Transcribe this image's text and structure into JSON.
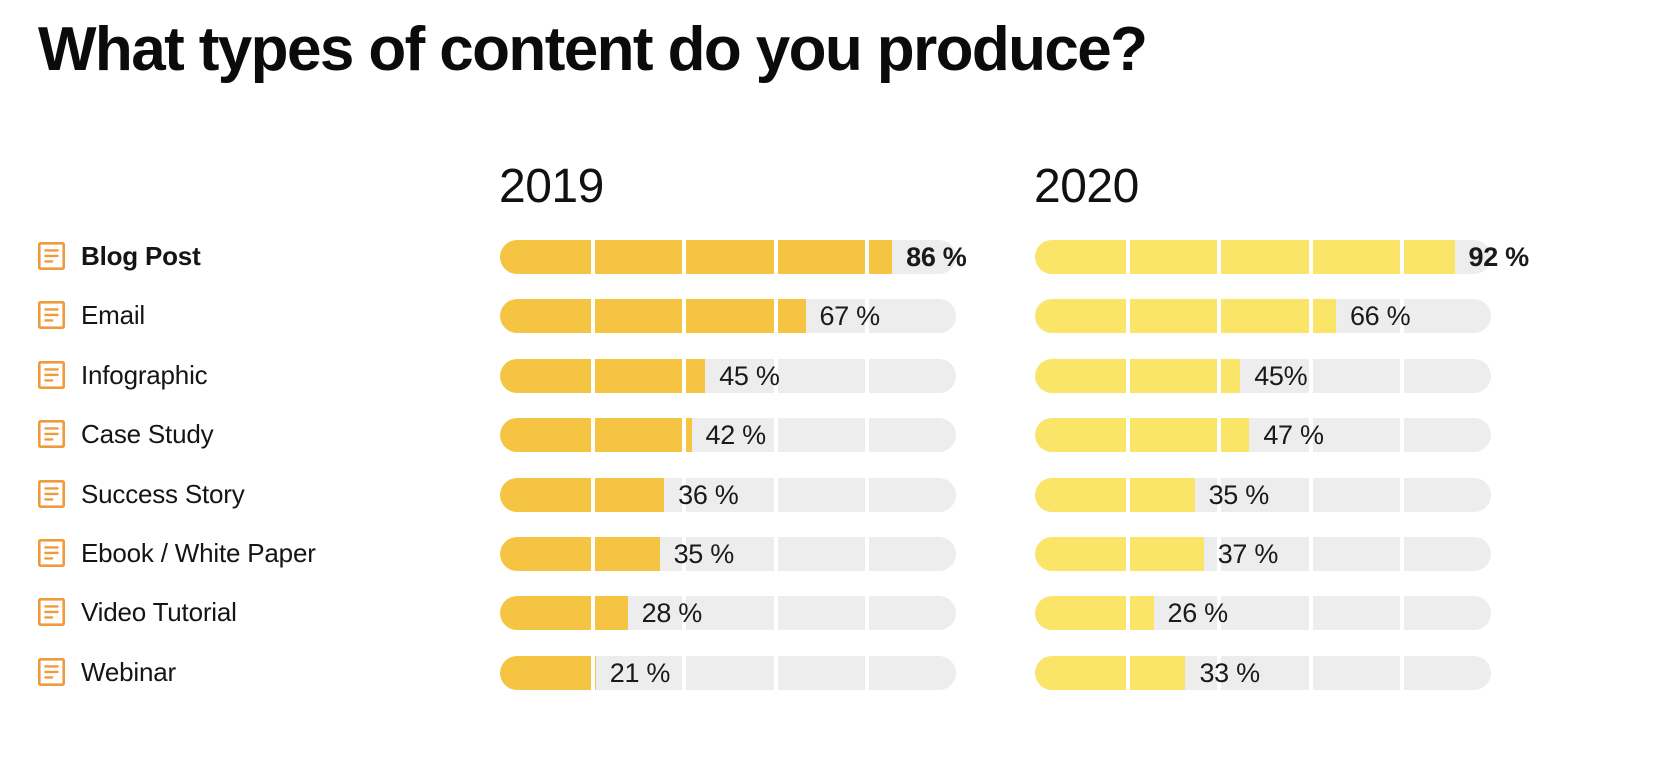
{
  "title": "What types of content do you produce?",
  "columns": [
    {
      "label": "2019",
      "key": "v2019",
      "color": "#F5C443"
    },
    {
      "label": "2020",
      "key": "v2020",
      "color": "#FAE568"
    }
  ],
  "icon": {
    "name": "document-icon",
    "color": "#F09A3E"
  },
  "track_color": "#EDEDED",
  "axis_max": 100,
  "segment_step": 20,
  "rows": [
    {
      "label": "Blog Post",
      "highlight": true,
      "v2019": 86,
      "v2019_text": "86 %",
      "v2020": 92,
      "v2020_text": "92 %"
    },
    {
      "label": "Email",
      "highlight": false,
      "v2019": 67,
      "v2019_text": "67 %",
      "v2020": 66,
      "v2020_text": "66 %"
    },
    {
      "label": "Infographic",
      "highlight": false,
      "v2019": 45,
      "v2019_text": "45 %",
      "v2020": 45,
      "v2020_text": "45%"
    },
    {
      "label": "Case Study",
      "highlight": false,
      "v2019": 42,
      "v2019_text": "42 %",
      "v2020": 47,
      "v2020_text": "47 %"
    },
    {
      "label": "Success Story",
      "highlight": false,
      "v2019": 36,
      "v2019_text": "36 %",
      "v2020": 35,
      "v2020_text": "35 %"
    },
    {
      "label": "Ebook / White Paper",
      "highlight": false,
      "v2019": 35,
      "v2019_text": "35 %",
      "v2020": 37,
      "v2020_text": "37 %"
    },
    {
      "label": "Video Tutorial",
      "highlight": false,
      "v2019": 28,
      "v2019_text": "28 %",
      "v2020": 26,
      "v2020_text": "26 %"
    },
    {
      "label": "Webinar",
      "highlight": false,
      "v2019": 21,
      "v2019_text": "21 %",
      "v2020": 33,
      "v2020_text": "33 %"
    }
  ],
  "chart_data": {
    "type": "bar",
    "orientation": "horizontal",
    "title": "What types of content do you produce?",
    "xlabel": "",
    "ylabel": "",
    "xlim": [
      0,
      100
    ],
    "unit": "%",
    "grid": false,
    "legend_position": "top (column headers)",
    "categories": [
      "Blog Post",
      "Email",
      "Infographic",
      "Case Study",
      "Success Story",
      "Ebook / White Paper",
      "Video Tutorial",
      "Webinar"
    ],
    "series": [
      {
        "name": "2019",
        "color": "#F5C443",
        "values": [
          86,
          67,
          45,
          42,
          36,
          35,
          28,
          21
        ]
      },
      {
        "name": "2020",
        "color": "#FAE568",
        "values": [
          92,
          66,
          45,
          47,
          35,
          37,
          26,
          33
        ]
      }
    ]
  }
}
